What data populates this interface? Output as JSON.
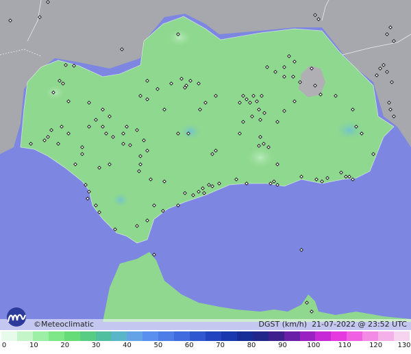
{
  "brand": "©Meteoclimatic",
  "info": {
    "variable": "DGST (km/h)",
    "datetime": "21-07-2022 @ 23:52 UTC"
  },
  "scale": {
    "ticks": [
      "0",
      "10",
      "20",
      "30",
      "40",
      "50",
      "60",
      "70",
      "80",
      "90",
      "100",
      "110",
      "120",
      "130"
    ],
    "colors": [
      "#e6fbe9",
      "#c4f5c9",
      "#9eefa6",
      "#7ee889",
      "#66dc79",
      "#57cd83",
      "#4fbfa0",
      "#58b6c8",
      "#64a4e6",
      "#5a8ff0",
      "#4f7de8",
      "#3f6bde",
      "#2f57cf",
      "#2245bf",
      "#1a38ad",
      "#162d98",
      "#20268a",
      "#3d1f8e",
      "#6a1fa8",
      "#9a22c2",
      "#c52ad6",
      "#e63ae0",
      "#f060e2",
      "#f38be4",
      "#f4b0e8",
      "#f6d4f0"
    ]
  },
  "map": {
    "sea_color": "#7d86e0",
    "land_color": "#8fd88f",
    "outside_land_color": "#a4a6ac",
    "north_africa_color": "#90d890"
  }
}
